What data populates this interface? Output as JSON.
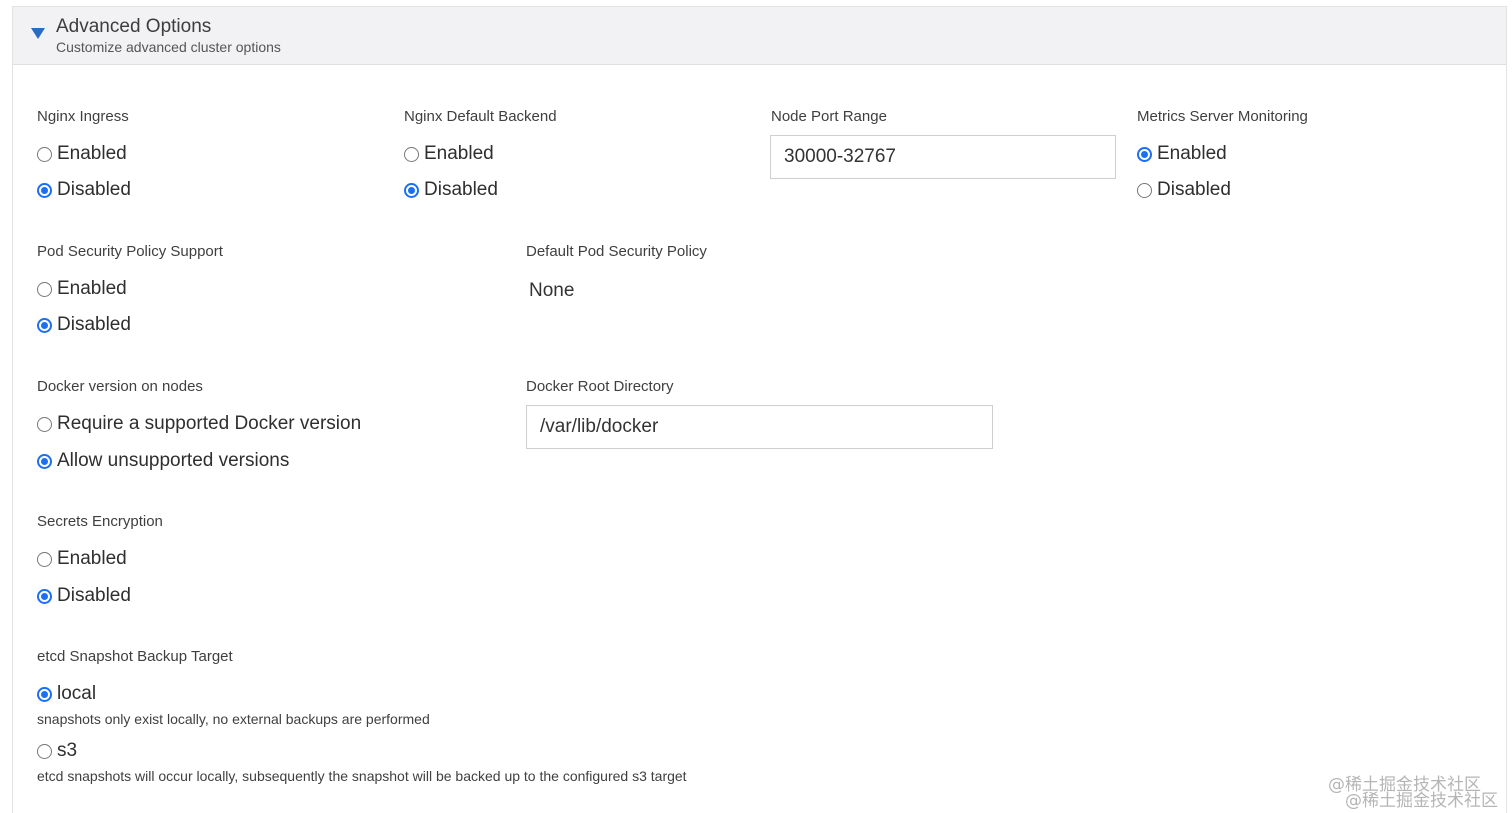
{
  "header": {
    "title": "Advanced Options",
    "subtitle": "Customize advanced cluster options",
    "expanded_icon": "caret-down-icon"
  },
  "nginx_ingress": {
    "label": "Nginx Ingress",
    "options": [
      {
        "label": "Enabled",
        "checked": false
      },
      {
        "label": "Disabled",
        "checked": true
      }
    ]
  },
  "nginx_default_backend": {
    "label": "Nginx Default Backend",
    "options": [
      {
        "label": "Enabled",
        "checked": false
      },
      {
        "label": "Disabled",
        "checked": true
      }
    ]
  },
  "node_port_range": {
    "label": "Node Port Range",
    "value": "30000-32767"
  },
  "metrics_server": {
    "label": "Metrics Server Monitoring",
    "options": [
      {
        "label": "Enabled",
        "checked": true
      },
      {
        "label": "Disabled",
        "checked": false
      }
    ]
  },
  "pod_security_policy": {
    "label": "Pod Security Policy Support",
    "options": [
      {
        "label": "Enabled",
        "checked": false
      },
      {
        "label": "Disabled",
        "checked": true
      }
    ]
  },
  "default_psp": {
    "label": "Default Pod Security Policy",
    "value": "None"
  },
  "docker_version": {
    "label": "Docker version on nodes",
    "options": [
      {
        "label": "Require a supported Docker version",
        "checked": false
      },
      {
        "label": "Allow unsupported versions",
        "checked": true
      }
    ]
  },
  "docker_root": {
    "label": "Docker Root Directory",
    "value": "/var/lib/docker"
  },
  "secrets_encryption": {
    "label": "Secrets Encryption",
    "options": [
      {
        "label": "Enabled",
        "checked": false
      },
      {
        "label": "Disabled",
        "checked": true
      }
    ]
  },
  "etcd_backup": {
    "label": "etcd Snapshot Backup Target",
    "options": [
      {
        "label": "local",
        "checked": true,
        "help": "snapshots only exist locally, no external backups are performed"
      },
      {
        "label": "s3",
        "checked": false,
        "help": "etcd snapshots will occur locally, subsequently the snapshot will be backed up to the configured s3 target"
      }
    ]
  },
  "watermark": {
    "line1": "@稀土掘金技术社区",
    "line2": "@稀土掘金技术社区"
  },
  "colors": {
    "accent": "#1d6ff2",
    "header_bg": "#f2f2f4"
  }
}
